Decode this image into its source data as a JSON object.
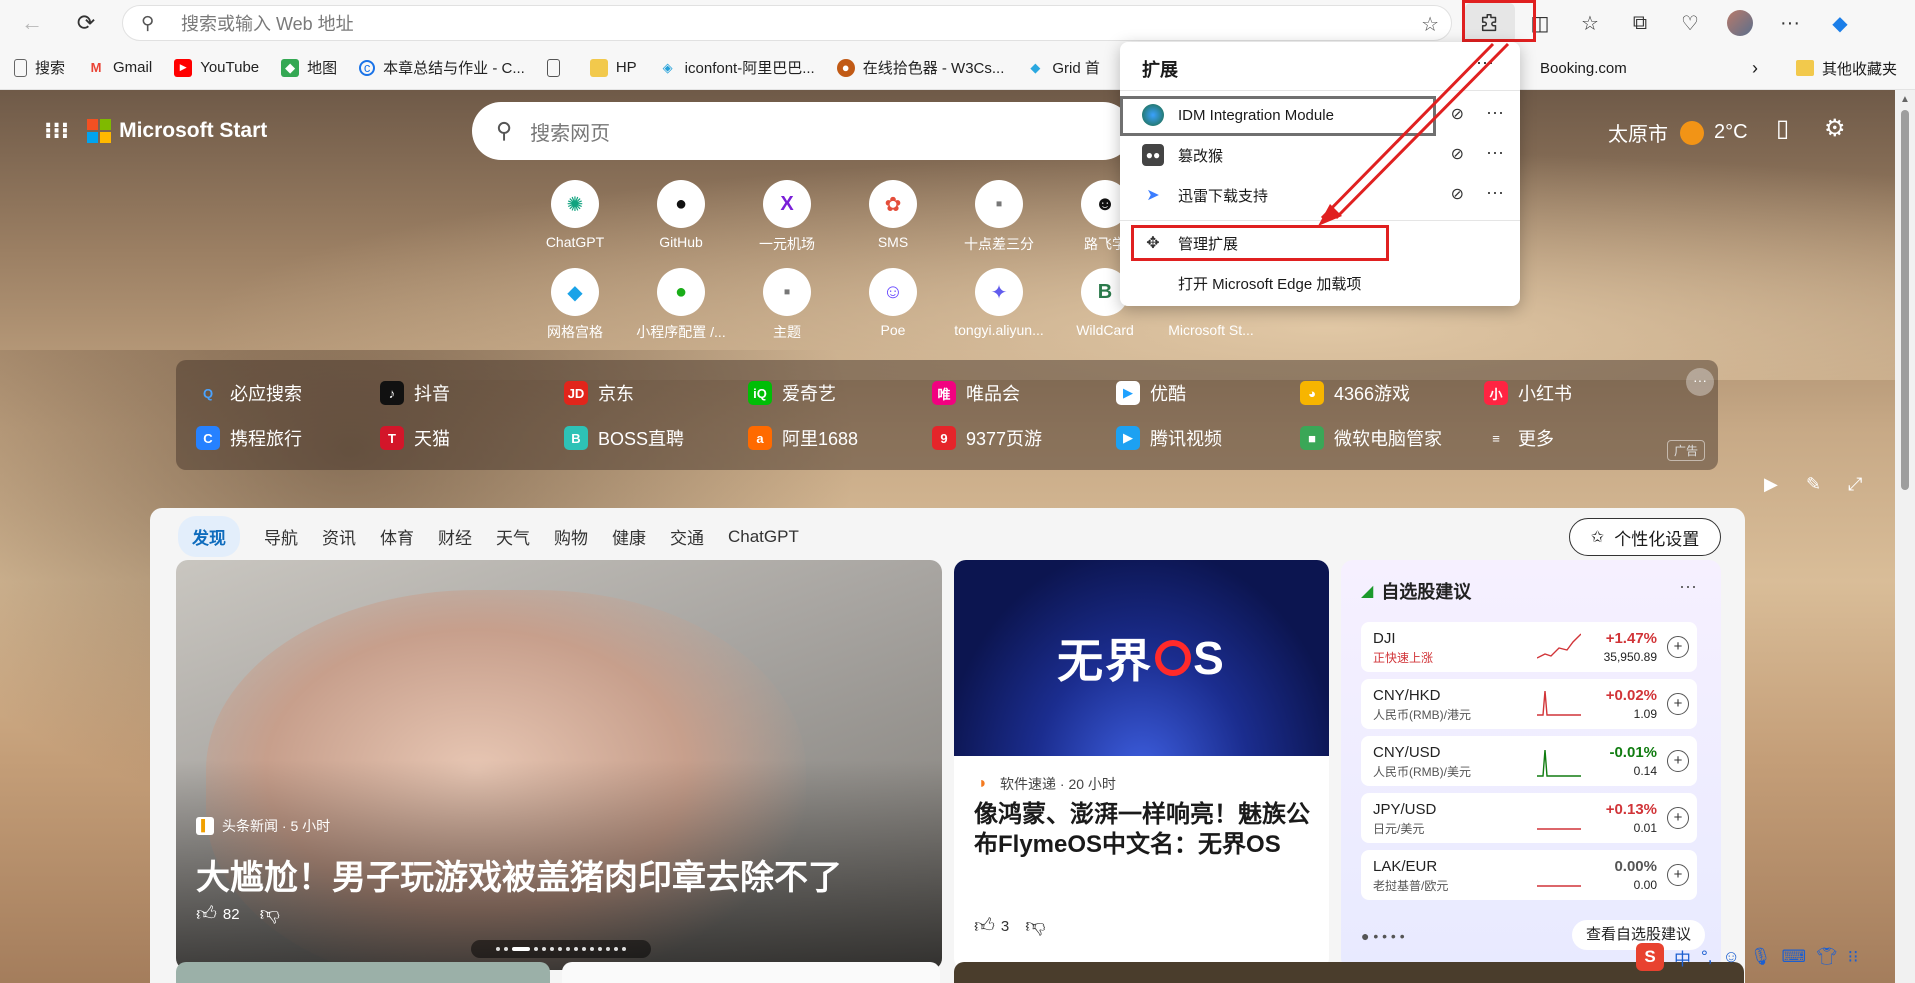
{
  "browser": {
    "address_placeholder": "搜索或输入 Web 地址",
    "favorites": [
      {
        "label": "搜索",
        "icon": "page-icon"
      },
      {
        "label": "Gmail",
        "icon": "gmail-icon"
      },
      {
        "label": "YouTube",
        "icon": "youtube-icon"
      },
      {
        "label": "地图",
        "icon": "maps-icon"
      },
      {
        "label": "本章总结与作业 - C...",
        "icon": "site-icon"
      },
      {
        "label": "",
        "icon": "page-icon"
      },
      {
        "label": "HP",
        "icon": "folder-icon"
      },
      {
        "label": "iconfont-阿里巴巴...",
        "icon": "iconfont-icon"
      },
      {
        "label": "在线拾色器 - W3Cs...",
        "icon": "w3c-icon"
      },
      {
        "label": "Grid 首",
        "icon": "grid-icon"
      }
    ],
    "fav_booking": "Booking.com",
    "fav_other": "其他收藏夹"
  },
  "extensions": {
    "title": "扩展",
    "items": [
      {
        "name": "IDM Integration Module",
        "icon": "idm-icon"
      },
      {
        "name": "篡改猴",
        "icon": "tampermonkey-icon"
      },
      {
        "name": "迅雷下载支持",
        "icon": "thunder-icon"
      }
    ],
    "manage": "管理扩展",
    "open_addons": "打开 Microsoft Edge 加载项"
  },
  "header": {
    "brand": "Microsoft Start",
    "search_placeholder": "搜索网页",
    "city": "太原市",
    "temp": "2°C"
  },
  "shortcuts": [
    {
      "label": "ChatGPT",
      "glyph": "✺",
      "color": "#10a37f"
    },
    {
      "label": "GitHub",
      "glyph": "●",
      "color": "#111111"
    },
    {
      "label": "一元机场",
      "glyph": "X",
      "color": "#7a1fd8"
    },
    {
      "label": "SMS",
      "glyph": "✿",
      "color": "#e44d3a"
    },
    {
      "label": "十点差三分",
      "glyph": "▪",
      "color": "#777777"
    },
    {
      "label": "路飞学",
      "glyph": "☻",
      "color": "#111111"
    },
    {
      "label": "网格宫格",
      "glyph": "◆",
      "color": "#1aa3e8"
    },
    {
      "label": "小程序配置 /...",
      "glyph": "●",
      "color": "#1aad19"
    },
    {
      "label": "主题",
      "glyph": "▪",
      "color": "#777777"
    },
    {
      "label": "Poe",
      "glyph": "☺",
      "color": "#6a4cff"
    },
    {
      "label": "tongyi.aliyun...",
      "glyph": "✦",
      "color": "#615ced"
    },
    {
      "label": "WildCard",
      "glyph": "B",
      "color": "#2b7a4b"
    },
    {
      "label": "Microsoft St...",
      "glyph": "",
      "color": "#ffffff"
    }
  ],
  "quick_links": [
    {
      "label": "必应搜索",
      "glyph": "Q",
      "bg": "transparent",
      "fg": "#4aa3ff"
    },
    {
      "label": "抖音",
      "glyph": "♪",
      "bg": "#111111",
      "fg": "#ffffff"
    },
    {
      "label": "京东",
      "glyph": "JD",
      "bg": "#e1251b",
      "fg": "#ffffff"
    },
    {
      "label": "爱奇艺",
      "glyph": "iQ",
      "bg": "#00be06",
      "fg": "#ffffff"
    },
    {
      "label": "唯品会",
      "glyph": "唯",
      "bg": "#f10180",
      "fg": "#ffffff"
    },
    {
      "label": "优酷",
      "glyph": "▶",
      "bg": "#ffffff",
      "fg": "#1ea1ff"
    },
    {
      "label": "4366游戏",
      "glyph": "◕",
      "bg": "#f7b500",
      "fg": "#ffffff"
    },
    {
      "label": "小红书",
      "glyph": "小",
      "bg": "#ff2442",
      "fg": "#ffffff"
    },
    {
      "label": "携程旅行",
      "glyph": "C",
      "bg": "#2681ff",
      "fg": "#ffffff"
    },
    {
      "label": "天猫",
      "glyph": "T",
      "bg": "#d3162a",
      "fg": "#ffffff"
    },
    {
      "label": "BOSS直聘",
      "glyph": "B",
      "bg": "#2ec2b6",
      "fg": "#ffffff"
    },
    {
      "label": "阿里1688",
      "glyph": "a",
      "bg": "#ff6a00",
      "fg": "#ffffff"
    },
    {
      "label": "9377页游",
      "glyph": "9",
      "bg": "#e5252a",
      "fg": "#ffffff"
    },
    {
      "label": "腾讯视频",
      "glyph": "▶",
      "bg": "#1da1f2",
      "fg": "#ffffff"
    },
    {
      "label": "微软电脑管家",
      "glyph": "■",
      "bg": "#3aa757",
      "fg": "#ffffff"
    },
    {
      "label": "更多",
      "glyph": "≡",
      "bg": "transparent",
      "fg": "#ffffff"
    }
  ],
  "ad_label": "广告",
  "feed": {
    "tabs": [
      "发现",
      "导航",
      "资讯",
      "体育",
      "财经",
      "天气",
      "购物",
      "健康",
      "交通",
      "ChatGPT"
    ],
    "personalize": "个性化设置",
    "main_card": {
      "source": "头条新闻 · 5 小时",
      "headline": "大尴尬！男子玩游戏被盖猪肉印章去除不了",
      "likes": "82"
    },
    "mid_card": {
      "image_text_1": "无界",
      "image_text_2": "S",
      "source": "软件速递 · 20 小时",
      "headline": "像鸿蒙、澎湃一样响亮！魅族公布FlymeOS中文名：无界OS",
      "likes": "3"
    },
    "stocks": {
      "title": "自选股建议",
      "rows": [
        {
          "sym": "DJI",
          "sub": "正快速上涨",
          "chg": "+1.47%",
          "val": "35,950.89",
          "trend": "up"
        },
        {
          "sym": "CNY/HKD",
          "sub": "人民币(RMB)/港元",
          "chg": "+0.02%",
          "val": "1.09",
          "trend": "spike"
        },
        {
          "sym": "CNY/USD",
          "sub": "人民币(RMB)/美元",
          "chg": "-0.01%",
          "val": "0.14",
          "trend": "down"
        },
        {
          "sym": "JPY/USD",
          "sub": "日元/美元",
          "chg": "+0.13%",
          "val": "0.01",
          "trend": "flat"
        },
        {
          "sym": "LAK/EUR",
          "sub": "老挝基普/欧元",
          "chg": "0.00%",
          "val": "0.00",
          "trend": "flat"
        }
      ],
      "watch_btn": "查看自选股建议"
    }
  },
  "ime": {
    "label": "中"
  }
}
